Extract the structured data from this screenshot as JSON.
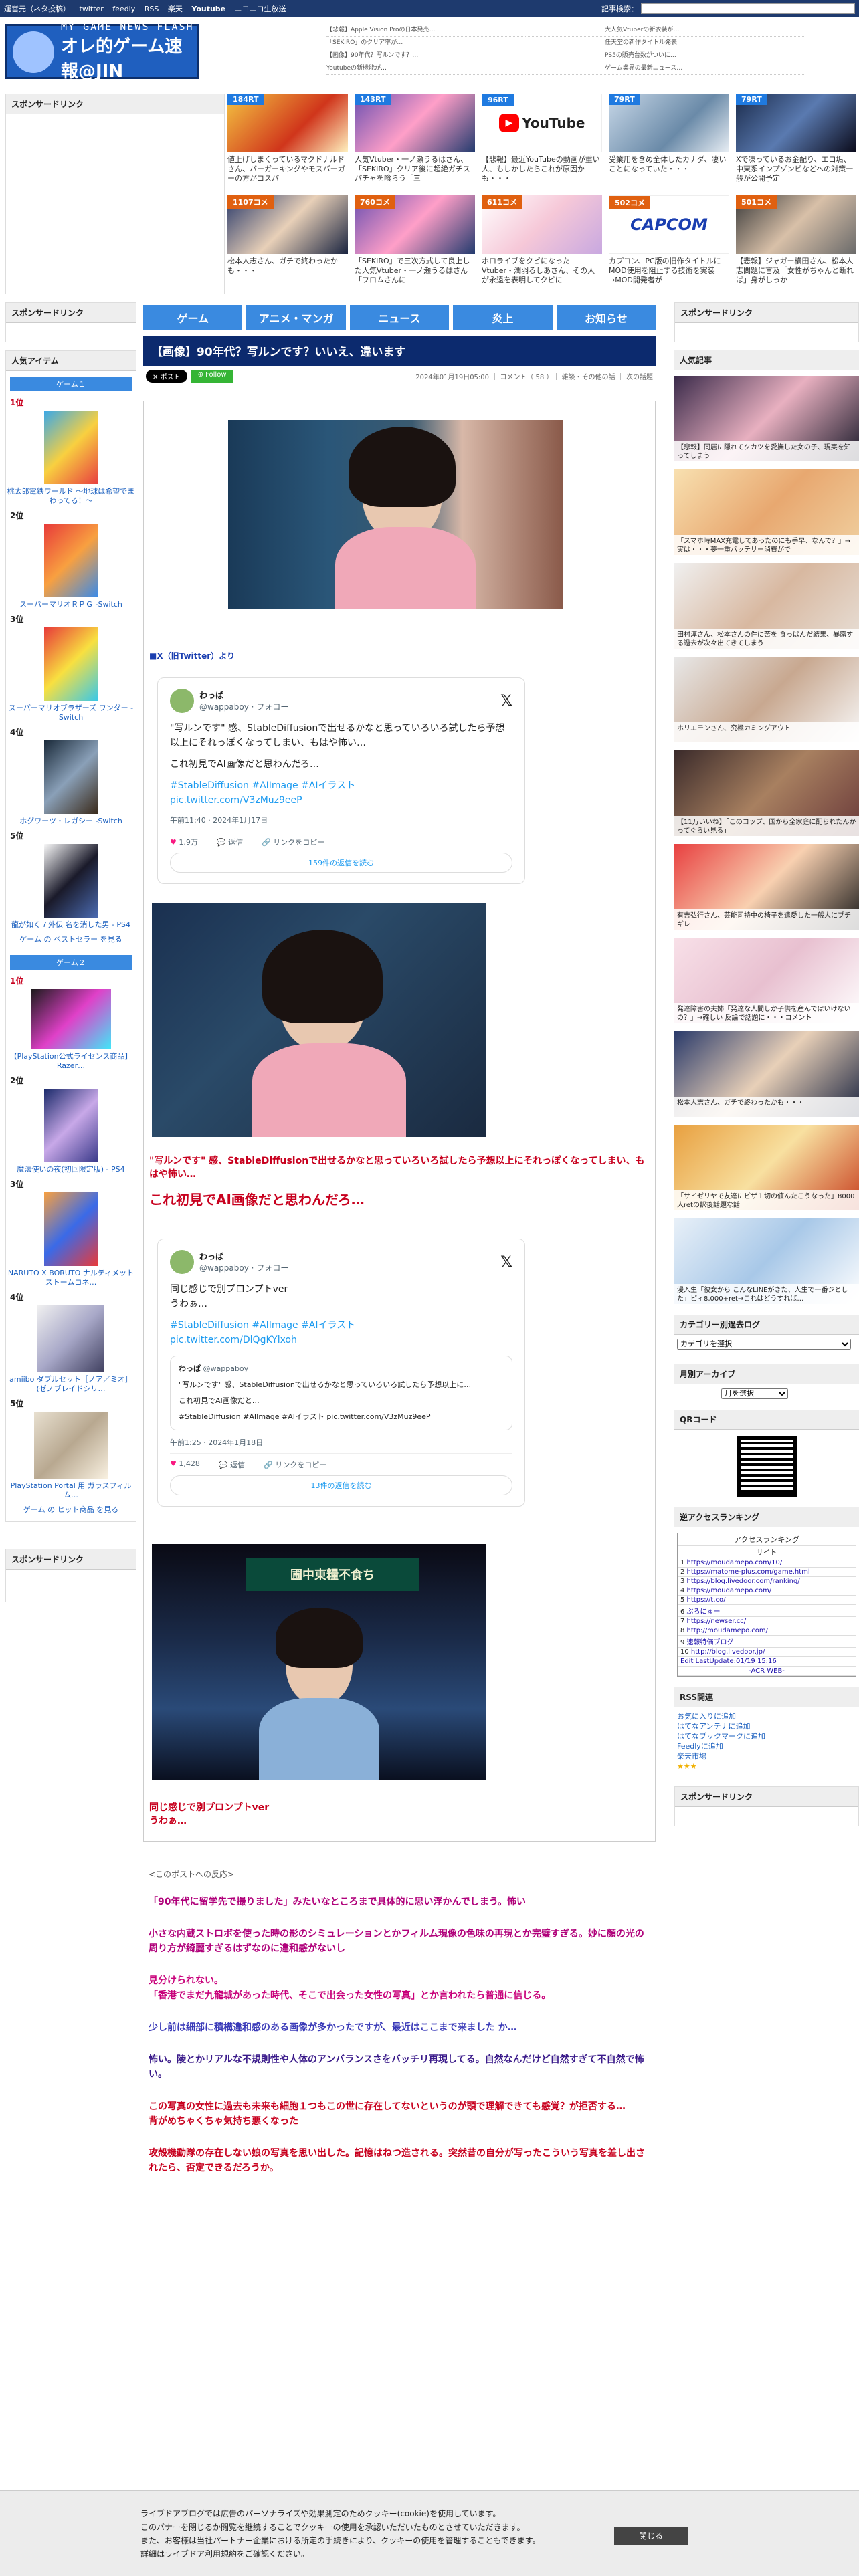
{
  "topbar": {
    "links": [
      "運営元（ネタ投稿）",
      "twitter",
      "feedly",
      "RSS",
      "楽天",
      "Youtube",
      "ニコニコ生放送"
    ],
    "search_label": "記事検索："
  },
  "header": {
    "logo_line1": "MY GAME NEWS FLASH",
    "logo_line2": "オレ的ゲーム速報@JIN",
    "col1": [
      "【悲報】Apple Vision Proの日本発売…",
      "「SEKIRO」のクリア率が…",
      "【画像】90年代？写ルンです？…",
      "Youtubeの新機能が…"
    ],
    "col2": [
      "大人気Vtuberの新衣装が…",
      "任天堂の新作タイトル発表…",
      "PS5の販売台数がついに…",
      "ゲーム業界の最新ニュース…"
    ]
  },
  "sponsor_label": "スポンサードリンク",
  "cards": [
    {
      "badge": "184RT",
      "text": "値上げしまくっているマクドナルドさん、バーガーキングやモスバーガーの方がコスパ",
      "hot": false
    },
    {
      "badge": "143RT",
      "text": "人気Vtuber・一ノ瀬うるはさん、「SEKIRO」クリア後に超絶ガチスパチャを喰らう「三",
      "hot": false
    },
    {
      "badge": "96RT",
      "text": "【悲報】最近YouTubeの動画が重い人、もしかしたらこれが原因かも・・・",
      "hot": false
    },
    {
      "badge": "79RT",
      "text": "受業用を含め全体したカナダ、凄いことになっていた・・・",
      "hot": false
    },
    {
      "badge": "79RT",
      "text": "Xで凍っているお金配り、エロ垢、中東系インプゾンビなどへの対策一般が公開予定",
      "hot": false
    },
    {
      "badge": "1107コメ",
      "text": "松本人志さん、ガチで終わったかも・・・",
      "hot": true
    },
    {
      "badge": "760コメ",
      "text": "「SEKIRO」で三次方式して良上した人気Vtuber・一ノ瀬うるはさん「フロムさんに",
      "hot": true
    },
    {
      "badge": "611コメ",
      "text": "ホロライブをクビになったVtuber・潤羽るしあさん、その人が永遠を表明してクビに",
      "hot": true
    },
    {
      "badge": "502コメ",
      "text": "カプコン、PC版の旧作タイトルにMOD使用を阻止する技術を実装→MOD開発者が",
      "hot": true
    },
    {
      "badge": "501コメ",
      "text": "【悲報】ジャガー横田さん、松本人志問題に言及「女性がちゃんと断れば」身がしっか",
      "hot": true
    }
  ],
  "left": {
    "sponsor": "スポンサードリンク",
    "popular": "人気アイテム",
    "game1_head": "ゲーム１",
    "game1": [
      {
        "rank": "1位",
        "title": "桃太郎電鉄ワールド ～地球は希望でまわってる！～"
      },
      {
        "rank": "2位",
        "title": "スーパーマリオＲＰＧ -Switch"
      },
      {
        "rank": "3位",
        "title": "スーパーマリオブラザーズ ワンダー -Switch"
      },
      {
        "rank": "4位",
        "title": "ホグワーツ・レガシー -Switch"
      },
      {
        "rank": "5位",
        "title": "龍が如く７外伝 名を消した男 - PS4"
      }
    ],
    "game1_more": "ゲーム の ベストセラー を見る",
    "game2_head": "ゲーム２",
    "game2": [
      {
        "rank": "1位",
        "title": "【PlayStation公式ライセンス商品】Razer…"
      },
      {
        "rank": "2位",
        "title": "魔法使いの夜(初回限定版) - PS4"
      },
      {
        "rank": "3位",
        "title": "NARUTO X BORUTO ナルティメットストームコネ…"
      },
      {
        "rank": "4位",
        "title": "amiibo ダブルセット［ノア／ミオ］(ゼノブレイドシリ…"
      },
      {
        "rank": "5位",
        "title": "PlayStation Portal 用 ガラスフィルム…"
      }
    ],
    "game2_more": "ゲーム の ヒット商品 を見る",
    "sponsor2": "スポンサードリンク"
  },
  "nav": [
    "ゲーム",
    "アニメ・マンガ",
    "ニュース",
    "炎上",
    "お知らせ"
  ],
  "article": {
    "title": "【画像】90年代？写ルンです？いいえ、違います",
    "post_label": "ポスト",
    "follow_label": "Follow",
    "meta": "2024年01月19日05:00 ｜ コメント（ 58 ）｜ 雑談・その他の話 ｜ 次の話題",
    "source": "■X（旧Twitter）より",
    "tweet1": {
      "name": "わっぱ",
      "handle": "@wappaboy · フォロー",
      "text": "\"写ルンです\" 感、StableDiffusionで出せるかなと思っていろいろ試したら予想以上にそれっぽくなってしまい、もはや怖い…",
      "text2": "これ初見でAI画像だと思わんだろ…",
      "tags": "#StableDiffusion #AIImage #AIイラスト",
      "link": "pic.twitter.com/V3zMuz9eeP",
      "time": "午前11:40 · 2024年1月17日",
      "likes": "1.9万",
      "reply": "返信",
      "share": "リンクをコピー",
      "more": "159件の返信を読む"
    },
    "caption1": "\"写ルンです\" 感、StableDiffusionで出せるかなと思っていろいろ試したら予想以上にそれっぽくなってしまい、もはや怖い…",
    "caption1b": "これ初見でAI画像だと思わんだろ…",
    "tweet2": {
      "name": "わっぱ",
      "handle": "@wappaboy · フォロー",
      "text": "同じ感じで別プロンプトver",
      "text2": "うわぁ…",
      "tags": "#StableDiffusion #AIImage #AIイラスト",
      "link": "pic.twitter.com/DlQgKYlxoh",
      "quote_name": "わっぱ",
      "quote_handle": "@wappaboy",
      "quote_text": "\"写ルンです\" 感、StableDiffusionで出せるかなと思っていろいろ試したら予想以上に…",
      "quote_text2": "これ初見でAI画像だと…",
      "quote_tags": "#StableDiffusion #AIImage #AIイラスト pic.twitter.com/V3zMuz9eeP",
      "time": "午前1:25 · 2024年1月18日",
      "likes": "1,428",
      "reply": "返信",
      "share": "リンクをコピー",
      "more": "13件の返信を読む"
    },
    "caption2": "同じ感じで別プロンプトver",
    "caption2b": "うわぁ…",
    "reactions_head": "<このポストへの反応>",
    "comments": [
      {
        "text": "「90年代に留学先で撮りました」みたいなところまで具体的に思い浮かんでしまう。怖い",
        "color": "#b0007a"
      },
      {
        "text": "小さな内蔵ストロボを使った時の影のシミュレーションとかフィルム現像の色味の再現とか完璧すぎる。妙に顔の光の周り方が綺麗すぎるはずなのに違和感がないし",
        "color": "#b0007a"
      },
      {
        "text": "見分けられない。\n「香港でまだ九龍城があった時代、そこで出会った女性の写真」とか言われたら普通に信じる。",
        "color": "#c8007a"
      },
      {
        "text": "少し前は細部に積構違和感のある画像が多かったですが、最近はここまで来ました か…",
        "color": "#3a3ab8"
      },
      {
        "text": "怖い。陵とかリアルな不規則性や人体のアンバランスさをバッチリ再現してる。自然なんだけど自然すぎて不自然で怖い。",
        "color": "#3a1a8a"
      },
      {
        "text": "この写真の女性に過去も未来も細胞１つもこの世に存在してないというのが頭で理解できても感覚？が拒否する…\n背がめちゃくちゃ気持ち悪くなった",
        "color": "#c8001e"
      },
      {
        "text": "攻殻機動隊の存在しない娘の写真を思い出した。記憶はねつ造される。突然昔の自分が写ったこういう写真を差し出されたら、否定できるだろうか。",
        "color": "#c8001e"
      }
    ]
  },
  "right": {
    "sponsor": "スポンサードリンク",
    "popular": "人気記事",
    "thumbs": [
      "【悲報】同居に隠れてクカツを愛撫した女の子、現実を知ってしまう",
      "「スマホ時MAX充電してあったのにも手早、なんで？」→実は・・・夢一重バッテリー消費がで",
      "田村淳さん、松本さんの件に苦を 食っぱんだ結果、暴露する過去が次々出てきてしまう",
      "ホリエモンさん、究極カミングアウト",
      "【11万いいね】「このコップ、国から全家庭に配られたんかってぐらい見る」",
      "有吉弘行さん、芸能司持中の椅子を遣愛した一般人にブチギレ",
      "発達障害の夫姉「発達な人間しか子供を産んではいけないの？」→確しい 反論で話題に・・・コメント",
      "松本人志さん、ガチで終わったかも・・・",
      "「サイゼリヤで友達にピザ１切の値んたこうなった」8000人retの訳後話題な話",
      "漫入生「彼女から こんなLINEがきた、人生で一番ジとした」ピィ8,000+ret→これはどうすれば…"
    ],
    "catlog_head": "カテゴリー別過去ログ",
    "cat_select": "カテゴリを選択",
    "monthly_head": "月別アーカイブ",
    "month_select": "月を選択",
    "qr_head": "QRコード",
    "rank_head": "逆アクセスランキング",
    "rank_title": "アクセスランキング",
    "rank_col": "サイト",
    "rank_items": [
      "https://moudamepo.com/10/",
      "https://matome-plus.com/game.html",
      "https://blog.livedoor.com/ranking/",
      "https://moudamepo.com/",
      "https://t.co/",
      "ぶろにゅー",
      "https://newser.cc/",
      "http://moudamepo.com/",
      "速報特価ブログ",
      "http://blog.livedoor.jp/"
    ],
    "rank_footer": "Edit LastUpdate:01/19 15:16",
    "rank_acr": "-ACR WEB-",
    "rss_head": "RSS関連",
    "rss_items": [
      "お気に入りに追加",
      "はてなアンテナに追加",
      "はてなブックマークに追加",
      "Feedlyに追加",
      "楽天市場"
    ],
    "sponsor2": "スポンサードリンク"
  },
  "cookie": {
    "line1": "ライブドアブログでは広告のパーソナライズや効果測定のためクッキー(cookie)を使用しています。",
    "line2": "このバナーを閉じるか閲覧を継続することでクッキーの使用を承認いただいたものとさせていただきます。",
    "line3": "また、お客様は当社パートナー企業における所定の手続きにより、クッキーの使用を管理することもできます。",
    "line4": "詳細はライブドア利用規約をご確認ください。",
    "close": "閉じる"
  }
}
